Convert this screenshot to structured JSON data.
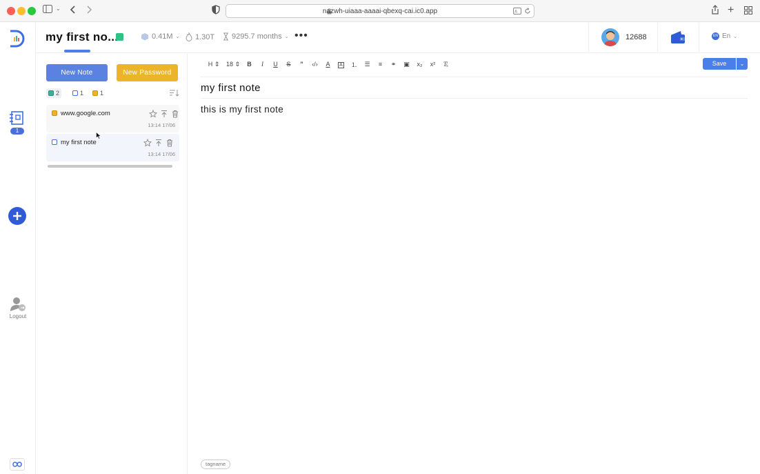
{
  "browser": {
    "url": "nazwh-uiaaa-aaaai-qbexq-cai.ic0.app"
  },
  "rail": {
    "notes_badge": "1",
    "logout_label": "Logout"
  },
  "header": {
    "title": "my first no...",
    "storage": "0.41M",
    "cycles": "1.30T",
    "duration": "9295.7 months",
    "points": "12688",
    "language": "En",
    "language_code": "EN"
  },
  "sidebar": {
    "new_note_label": "New Note",
    "new_password_label": "New Password",
    "filters": [
      {
        "count": "2",
        "type": "all"
      },
      {
        "count": "1",
        "type": "note"
      },
      {
        "count": "1",
        "type": "password"
      }
    ],
    "items": [
      {
        "name": "www.google.com",
        "date": "13:14 17/06",
        "type": "password"
      },
      {
        "name": "my first note",
        "date": "13:14 17/06",
        "type": "note"
      }
    ]
  },
  "editor": {
    "heading_label": "H",
    "font_size": "18",
    "save_label": "Save",
    "note_title": "my first note",
    "note_body": "this is my first note",
    "tag_placeholder": "tagname"
  },
  "colors": {
    "primary": "#5b82e0",
    "accent_yellow": "#ebb42a",
    "save_blue": "#4a7ee8"
  }
}
